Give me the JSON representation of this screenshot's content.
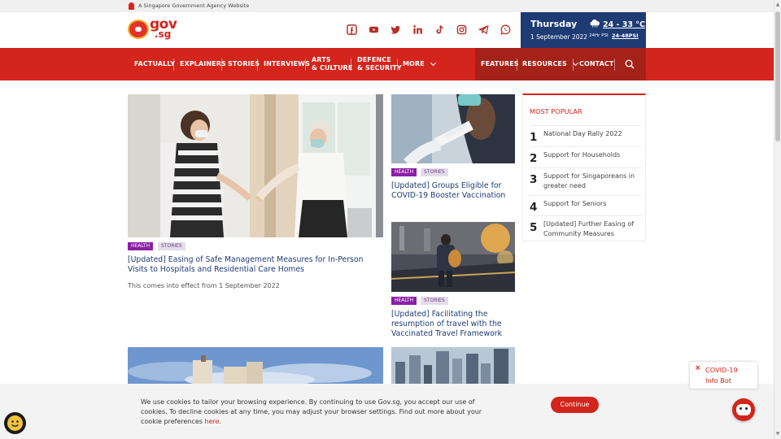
{
  "topbar": {
    "gov_notice": "A Singapore Government Agency Website"
  },
  "logo": {
    "line1": "gov",
    "line2": ".sg"
  },
  "social": [
    "facebook-icon",
    "youtube-icon",
    "twitter-icon",
    "linkedin-icon",
    "tiktok-icon",
    "instagram-icon",
    "telegram-icon",
    "whatsapp-icon"
  ],
  "weather": {
    "day": "Thursday",
    "date": "1 September 2022",
    "temperature": "24 - 33 °C",
    "psi_label": "24Hr PSI",
    "psi_value": "24-48PSI"
  },
  "nav": {
    "factually": "FACTUALLY",
    "explainers": "EXPLAINERS",
    "stories": "STORIES",
    "interviews": "INTERVIEWS",
    "arts_1": "ARTS",
    "arts_2": "& CULTURE",
    "defence_1": "DEFENCE",
    "defence_2": "& SECURITY",
    "more": "MORE",
    "features": "FEATURES",
    "resources": "RESOURCES",
    "contact": "CONTACT"
  },
  "articles": [
    {
      "tag1": "HEALTH",
      "tag2": "STORIES",
      "title": "[Updated] Easing of Safe Management Measures for In-Person Visits to Hospitals and Residential Care Homes",
      "desc": "This comes into effect from 1 September 2022"
    },
    {
      "tag1": "HEALTH",
      "tag2": "STORIES",
      "title": "[Updated] Groups Eligible for COVID-19 Booster Vaccination"
    },
    {
      "tag1": "HEALTH",
      "tag2": "STORIES",
      "title": "[Updated] Facilitating the resumption of travel with the Vaccinated Travel Framework"
    }
  ],
  "popular": {
    "heading": "MOST POPULAR",
    "items": [
      {
        "num": "1",
        "label": "National Day Rally 2022"
      },
      {
        "num": "2",
        "label": "Support for Households"
      },
      {
        "num": "3",
        "label": "Support for Singaporeans in greater need"
      },
      {
        "num": "4",
        "label": "Support for Seniors"
      },
      {
        "num": "5",
        "label": "[Updated] Further Easing of Community Measures"
      }
    ]
  },
  "cookie": {
    "text": "We use cookies to tailor your browsing experience. By continuing to use Gov.sg, you accept our use of cookies. To decline cookies at any time, you may adjust your browser settings. Find out more about your cookie preferences ",
    "link": "here",
    "end": ".",
    "button": "Continue"
  },
  "chatbot": {
    "line1": "COVID-19",
    "line2": "Info Bot"
  },
  "colors": {
    "brand_red": "#d3251c",
    "dark_red": "#a52219",
    "navy": "#1f3b74",
    "health_purple": "#8b1fa6"
  }
}
